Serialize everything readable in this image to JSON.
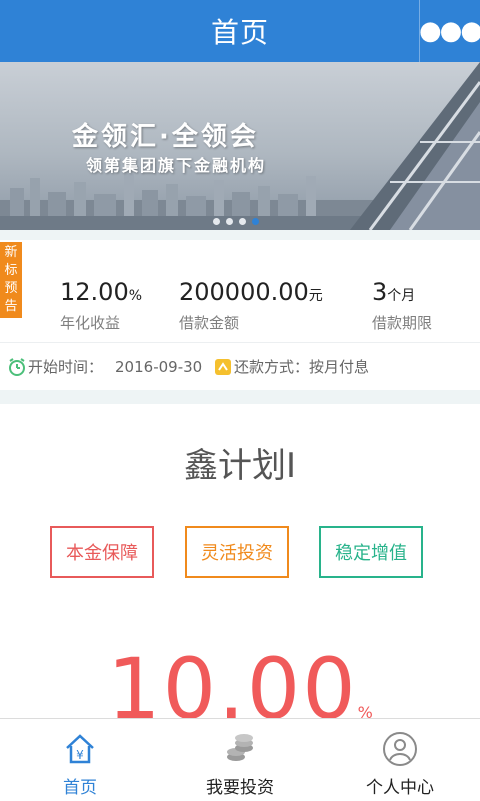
{
  "header": {
    "title": "首页",
    "more_icon": "more-dots-icon"
  },
  "banner": {
    "headline": "金领汇·全领会",
    "subline": "领第集团旗下金融机构",
    "slides": 4,
    "active_slide": 4
  },
  "loan": {
    "tag": "新标预告",
    "rate": {
      "value": "12.00",
      "unit": "%",
      "label": "年化收益"
    },
    "amount": {
      "value": "200000.00",
      "unit": "元",
      "label": "借款金额"
    },
    "term": {
      "value": "3",
      "unit": "个月",
      "label": "借款期限"
    },
    "start": {
      "label": "开始时间：",
      "value": "2016-09-30",
      "icon": "alarm-clock-icon"
    },
    "repay": {
      "label": "还款方式：",
      "value": "按月付息",
      "icon": "repayment-icon"
    }
  },
  "product": {
    "name": "鑫计划I",
    "features": [
      {
        "label": "本金保障",
        "color": "#e85a5a"
      },
      {
        "label": "灵活投资",
        "color": "#f08a1c"
      },
      {
        "label": "稳定增值",
        "color": "#28b38b"
      }
    ],
    "rate_value": "10.00",
    "rate_unit": "%"
  },
  "tabs": [
    {
      "label": "首页",
      "icon": "home-yen-icon",
      "active": true
    },
    {
      "label": "我要投资",
      "icon": "coins-icon",
      "active": false
    },
    {
      "label": "个人中心",
      "icon": "user-icon",
      "active": false
    }
  ],
  "colors": {
    "primary": "#2f82d6",
    "accent_orange": "#f08a1c",
    "rate_red": "#f05a5a"
  }
}
